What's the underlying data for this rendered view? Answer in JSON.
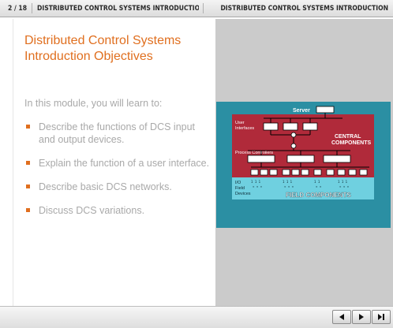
{
  "header": {
    "page_counter": "2 / 18",
    "slide_title": "DISTRIBUTED CONTROL SYSTEMS INTRODUCTION OBJECTIVES",
    "course_title": "DISTRIBUTED CONTROL SYSTEMS INTRODUCTION"
  },
  "content": {
    "heading": "Distributed Control Systems Introduction Objectives",
    "intro": "In this module, you will learn to:",
    "objectives": [
      "Describe the functions of DCS input and output devices.",
      "Explain the function of a user interface.",
      "Describe basic DCS networks.",
      "Discuss DCS variations."
    ]
  },
  "diagram": {
    "server_label": "Server",
    "user_interfaces_label": [
      "User",
      "Interfaces"
    ],
    "central_components_label": [
      "CENTRAL",
      "COMPONENTS"
    ],
    "process_controllers_label": "Process Controllers",
    "io_label": [
      "I/O",
      "Field",
      "Devices"
    ],
    "field_components_label": "FIELD COMPONENTS"
  },
  "colors": {
    "accent": "#e06f1f",
    "body_text": "#a9a9a9",
    "diagram_bg": "#2b8fa3",
    "central_band": "#b02a3a",
    "field_band": "#6fd0e0"
  },
  "nav": {
    "back_icon": "triangle-left-icon",
    "next_icon": "triangle-right-icon",
    "end_icon": "skip-end-icon"
  }
}
